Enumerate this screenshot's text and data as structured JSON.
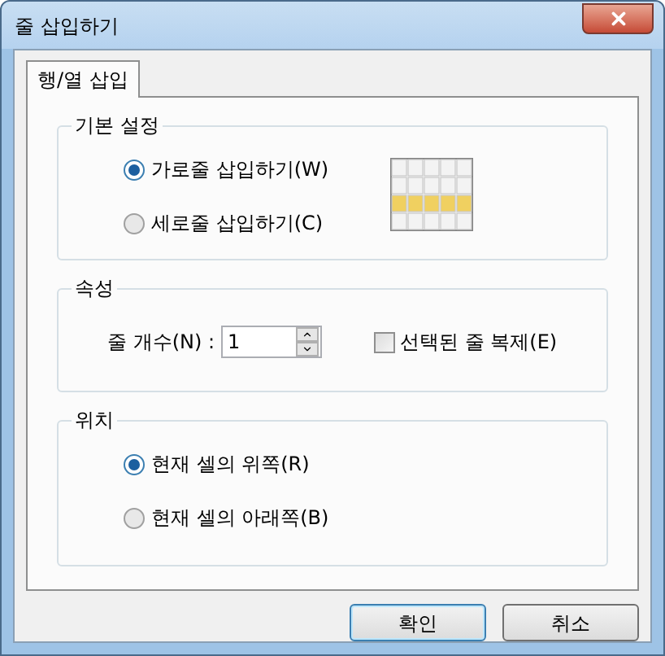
{
  "window": {
    "title": "줄 삽입하기"
  },
  "tabs": [
    {
      "label": "행/열 삽입",
      "selected": true
    }
  ],
  "groups": [
    {
      "title": "기본 설정",
      "kind": "radios",
      "options": [
        {
          "label": "가로줄 삽입하기(W)",
          "selected": true
        },
        {
          "label": "세로줄 삽입하기(C)",
          "selected": false
        }
      ],
      "preview": true
    },
    {
      "title": "속성",
      "kind": "props",
      "count_label": "줄 개수(N) :",
      "count_value": "1",
      "checkbox": {
        "label": "선택된 줄 복제(E)",
        "checked": false
      }
    },
    {
      "title": "위치",
      "kind": "radios",
      "options": [
        {
          "label": "현재 셀의 위쪽(R)",
          "selected": true
        },
        {
          "label": "현재 셀의 아래쪽(B)",
          "selected": false
        }
      ]
    }
  ],
  "buttons": [
    {
      "label": "확인",
      "default": true
    },
    {
      "label": "취소",
      "default": false
    }
  ]
}
